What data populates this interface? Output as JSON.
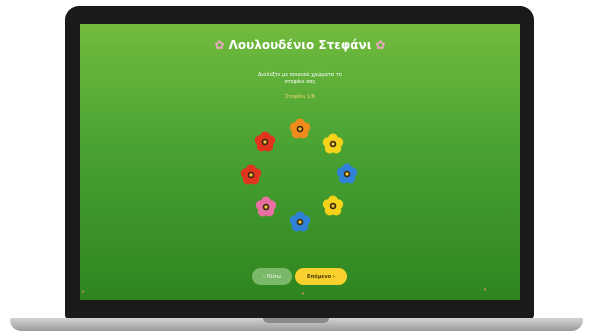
{
  "app": {
    "title": "Λουλουδένιο Στεφάνι",
    "title_icon": "flower-icon"
  },
  "instructions": {
    "line1": "Διαλέξτε με ποιανού χρώματα το",
    "line2": "στεφάνι σας"
  },
  "progress_text": "Στεφάνι 1/8",
  "wreath": {
    "flowers": [
      {
        "color": "#f08a1c"
      },
      {
        "color": "#f5d31a"
      },
      {
        "color": "#2f82d6"
      },
      {
        "color": "#f5d31a"
      },
      {
        "color": "#2f82d6"
      },
      {
        "color": "#e86fa2"
      },
      {
        "color": "#e0341e"
      },
      {
        "color": "#e0341e"
      }
    ]
  },
  "buttons": {
    "prev_label": "‹ Πίσω",
    "next_label": "Επόμενο ›"
  },
  "colors": {
    "background_top": "#72bb3e",
    "background_bottom": "#2e851f",
    "next_button": "#f8d12f",
    "prev_button": "#7ab86a",
    "progress_text": "#f7d86b"
  }
}
